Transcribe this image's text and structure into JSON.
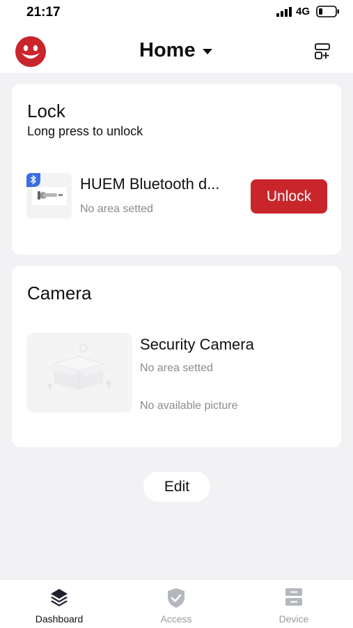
{
  "status_bar": {
    "time": "21:17",
    "network": "4G",
    "icons": [
      "signal-icon",
      "battery-icon"
    ]
  },
  "header": {
    "title": "Home",
    "avatar_icon": "smiley-avatar-icon",
    "add_icon": "add-card-icon",
    "brand_color": "#c9262c"
  },
  "lock_card": {
    "title": "Lock",
    "subtitle": "Long press to unlock",
    "device": {
      "name": "HUEM Bluetooth d...",
      "area": "No area setted",
      "badge_icon": "bluetooth-icon",
      "action_label": "Unlock"
    }
  },
  "camera_card": {
    "title": "Camera",
    "device": {
      "name": "Security Camera",
      "area": "No area setted",
      "picture_status": "No available picture"
    }
  },
  "edit_label": "Edit",
  "bottom_nav": {
    "items": [
      {
        "label": "Dashboard",
        "icon": "layers-icon",
        "active": true
      },
      {
        "label": "Access",
        "icon": "shield-check-icon",
        "active": false
      },
      {
        "label": "Device",
        "icon": "device-list-icon",
        "active": false
      }
    ]
  }
}
